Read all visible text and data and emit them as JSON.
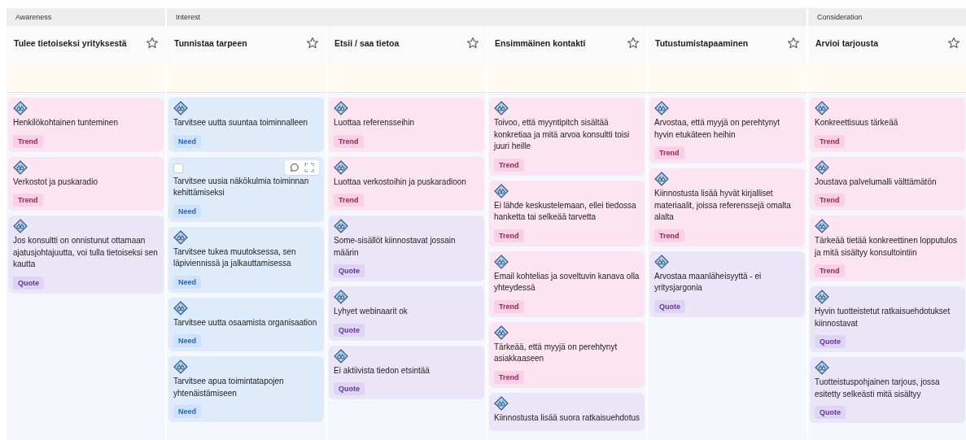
{
  "phases": [
    {
      "label": "Awareness",
      "stages": [
        {
          "title": "Tulee tietoiseksi yrityksestä",
          "starred": false,
          "cards": [
            {
              "kind": "trend",
              "text": "Henkilökohtainen tunteminen",
              "tag": "Trend",
              "hovered": false
            },
            {
              "kind": "trend",
              "text": "Verkostot ja puskaradio",
              "tag": "Trend",
              "hovered": false
            },
            {
              "kind": "quote",
              "text": "Jos konsultti on onnistunut ottamaan ajatusjohtajuutta, voi tulla tietoiseksi sen kautta",
              "tag": "Quote",
              "hovered": false
            }
          ]
        }
      ]
    },
    {
      "label": "Interest",
      "stages": [
        {
          "title": "Tunnistaa tarpeen",
          "starred": false,
          "cards": [
            {
              "kind": "need",
              "text": "Tarvitsee uutta suuntaa toiminnalleen",
              "tag": "Need",
              "hovered": false
            },
            {
              "kind": "need",
              "text": "Tarvitsee uusia näkökulmia toiminnan kehittämiseksi",
              "tag": "Need",
              "hovered": true,
              "checked": false
            },
            {
              "kind": "need",
              "text": "Tarvitsee tukea muutoksessa, sen läpiviennissä ja jalkauttamisessa",
              "tag": "Need",
              "hovered": false
            },
            {
              "kind": "need",
              "text": "Tarvitsee uutta osaamista organisaation",
              "tag": "Need",
              "hovered": false
            },
            {
              "kind": "need",
              "text": "Tarvitsee apua toimintatapojen yhtenäistämiseen",
              "tag": "Need",
              "hovered": false
            }
          ]
        },
        {
          "title": "Etsii / saa tietoa",
          "starred": false,
          "cards": [
            {
              "kind": "trend",
              "text": "Luottaa referensseihin",
              "tag": "Trend",
              "hovered": false
            },
            {
              "kind": "trend",
              "text": "Luottaa verkostoihin ja puskaradioon",
              "tag": "Trend",
              "hovered": false
            },
            {
              "kind": "quote",
              "text": "Some-sisällöt kiinnostavat jossain määrin",
              "tag": "Quote",
              "hovered": false
            },
            {
              "kind": "quote",
              "text": "Lyhyet webinaarit ok",
              "tag": "Quote",
              "hovered": false
            },
            {
              "kind": "quote",
              "text": "Ei aktiivista tiedon etsintää",
              "tag": "Quote",
              "hovered": false
            }
          ]
        },
        {
          "title": "Ensimmäinen kontakti",
          "starred": false,
          "cards": [
            {
              "kind": "trend",
              "text": "Toivoo, että myyntipitch sisältää konkretiaa ja mitä arvoa konsultti toisi juuri heille",
              "tag": "Trend",
              "hovered": false
            },
            {
              "kind": "trend",
              "text": "Ei lähde keskustelemaan, ellei tiedossa hanketta tai selkeää tarvetta",
              "tag": "Trend",
              "hovered": false
            },
            {
              "kind": "trend",
              "text": "Email kohtelias ja soveltuvin kanava olla yhteydessä",
              "tag": "Trend",
              "hovered": false
            },
            {
              "kind": "trend",
              "text": "Tärkeää, että myyjä on perehtynyt asiakkaaseen",
              "tag": "Trend",
              "hovered": false
            },
            {
              "kind": "quote",
              "text": "Kiinnostusta lisää suora ratkaisuehdotus",
              "hovered": false
            }
          ]
        },
        {
          "title": "Tutustumistapaaminen",
          "starred": false,
          "cards": [
            {
              "kind": "trend",
              "text": "Arvostaa, että myyjä on perehtynyt hyvin etukäteen heihin",
              "tag": "Trend",
              "hovered": false
            },
            {
              "kind": "trend",
              "text": "Kiinnostusta lisää hyvät kirjalliset materiaalit, joissa referenssejä omalta alalta",
              "tag": "Trend",
              "hovered": false
            },
            {
              "kind": "quote",
              "text": "Arvostaa maanläheisyyttä - ei yritysjargonia",
              "tag": "Quote",
              "hovered": false
            }
          ]
        }
      ]
    },
    {
      "label": "Consideration",
      "stages": [
        {
          "title": "Arvioi tarjousta",
          "starred": false,
          "cards": [
            {
              "kind": "trend",
              "text": "Konkreettisuus tärkeää",
              "tag": "Trend",
              "hovered": false
            },
            {
              "kind": "trend",
              "text": "Joustava palvelumalli välttämätön",
              "tag": "Trend",
              "hovered": false
            },
            {
              "kind": "trend",
              "text": "Tärkeää tietää konkreettinen lopputulos ja mitä sisältyy konsultointiin",
              "tag": "Trend",
              "hovered": false
            },
            {
              "kind": "quote",
              "text": "Hyvin tuotteistetut ratkaisuehdotukset kiinnostavat",
              "tag": "Quote",
              "hovered": false
            },
            {
              "kind": "quote",
              "text": "Tuotteistuspohjainen tarjous, jossa esitetty selkeästi mitä sisältyy",
              "tag": "Quote",
              "hovered": false
            }
          ]
        }
      ]
    }
  ]
}
